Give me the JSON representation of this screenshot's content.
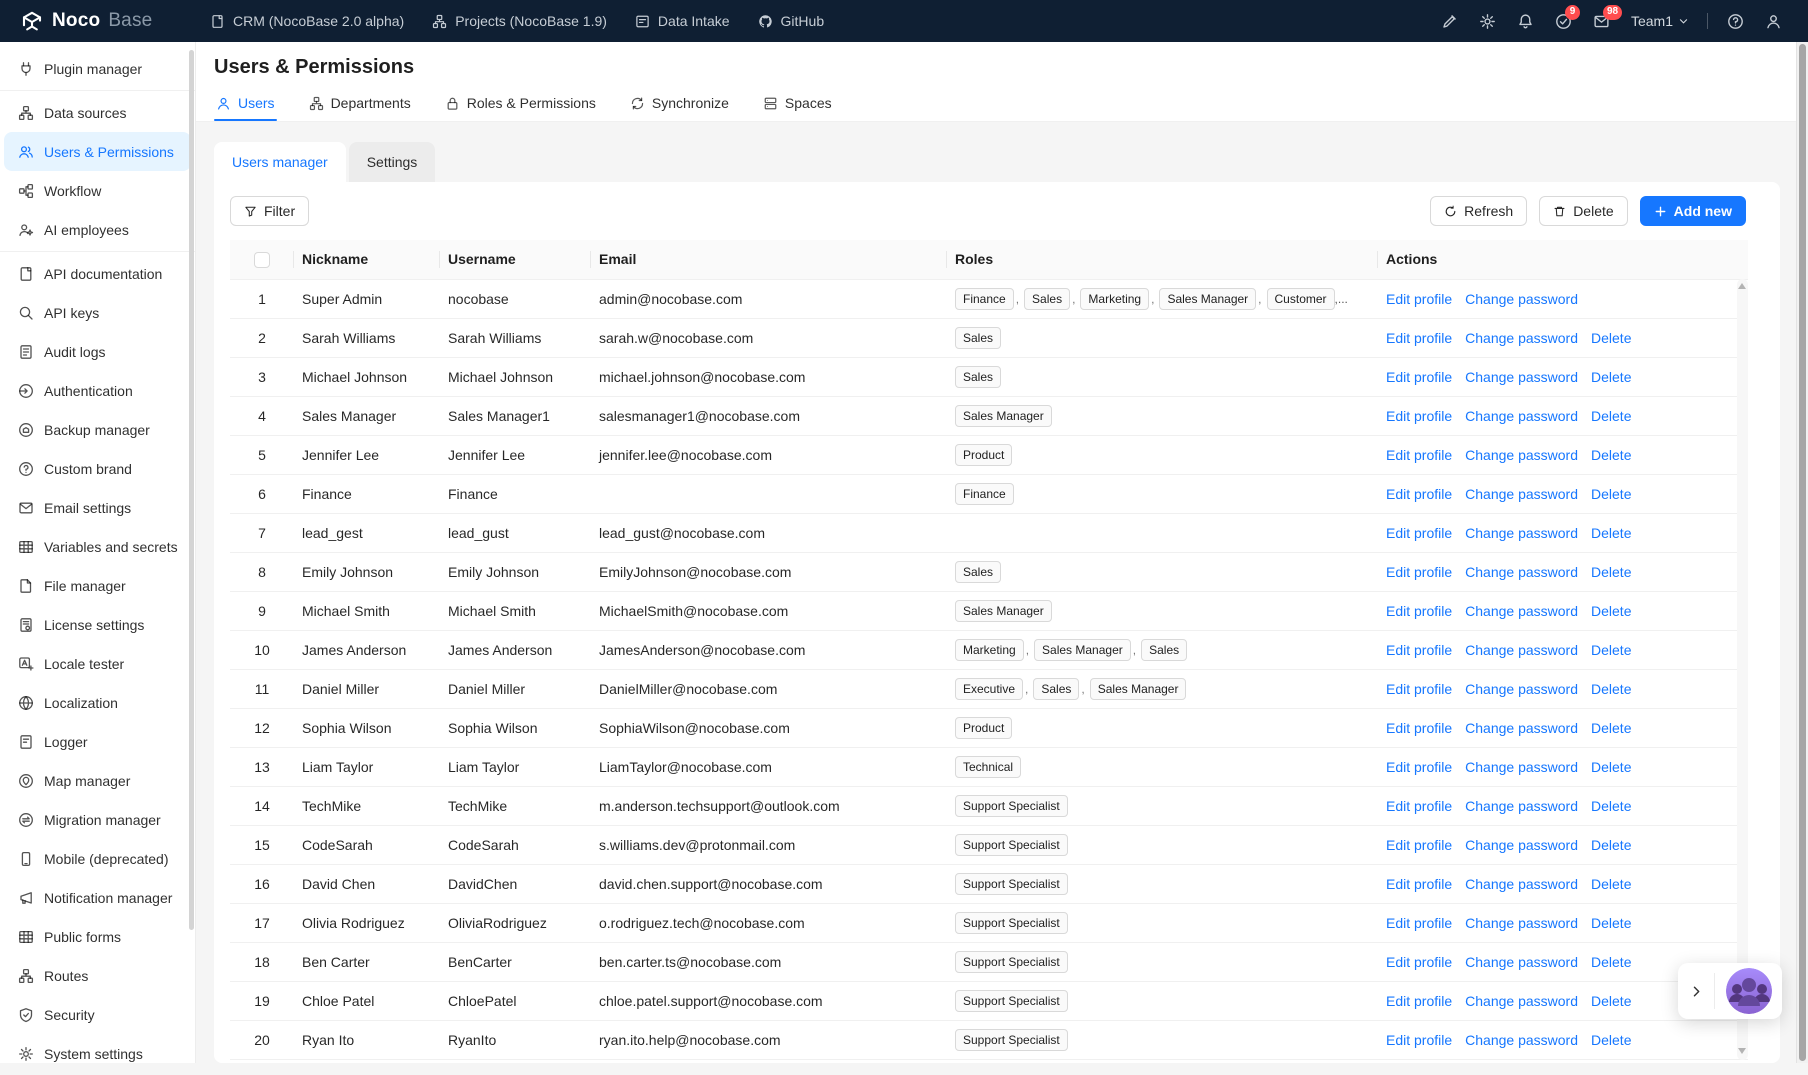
{
  "colors": {
    "accent": "#1677ff",
    "topbar_bg": "#0f1f33",
    "badge": "#ff4d4f",
    "active_item_bg": "#e6f4ff"
  },
  "topbar": {
    "logo": {
      "bold": "Noco",
      "light": "Base"
    },
    "menu": [
      {
        "icon": "doc-icon",
        "label": "CRM (NocoBase 2.0 alpha)"
      },
      {
        "icon": "sitemap-icon",
        "label": "Projects (NocoBase 1.9)"
      },
      {
        "icon": "intake-icon",
        "label": "Data Intake"
      },
      {
        "icon": "github-icon",
        "label": "GitHub"
      }
    ],
    "actions": [
      {
        "icon": "highlighter-icon",
        "badge": ""
      },
      {
        "icon": "gear-icon",
        "badge": ""
      },
      {
        "icon": "bell-icon",
        "badge": ""
      },
      {
        "icon": "todo-icon",
        "badge": "9"
      },
      {
        "icon": "inbox-icon",
        "badge": "98"
      }
    ],
    "team": {
      "label": "Team1"
    }
  },
  "sidebar": {
    "groups": [
      [
        {
          "icon": "plug-icon",
          "label": "Plugin manager",
          "active": false
        }
      ],
      [
        {
          "icon": "sitemap-icon",
          "label": "Data sources",
          "active": false
        },
        {
          "icon": "users-icon",
          "label": "Users & Permissions",
          "active": true
        },
        {
          "icon": "workflow-icon",
          "label": "Workflow",
          "active": false
        },
        {
          "icon": "ai-icon",
          "label": "AI employees",
          "active": false
        }
      ],
      [
        {
          "icon": "api-doc-icon",
          "label": "API documentation",
          "active": false
        },
        {
          "icon": "search-icon",
          "label": "API keys",
          "active": false
        },
        {
          "icon": "audit-icon",
          "label": "Audit logs",
          "active": false
        },
        {
          "icon": "auth-icon",
          "label": "Authentication",
          "active": false
        },
        {
          "icon": "backup-icon",
          "label": "Backup manager",
          "active": false
        },
        {
          "icon": "brand-icon",
          "label": "Custom brand",
          "active": false
        },
        {
          "icon": "mail-icon",
          "label": "Email settings",
          "active": false
        },
        {
          "icon": "grid-icon",
          "label": "Variables and secrets",
          "active": false
        },
        {
          "icon": "file-icon",
          "label": "File manager",
          "active": false
        },
        {
          "icon": "license-icon",
          "label": "License settings",
          "active": false
        },
        {
          "icon": "locale-icon",
          "label": "Locale tester",
          "active": false
        },
        {
          "icon": "globe-icon",
          "label": "Localization",
          "active": false
        },
        {
          "icon": "logger-icon",
          "label": "Logger",
          "active": false
        },
        {
          "icon": "map-icon",
          "label": "Map manager",
          "active": false
        },
        {
          "icon": "migration-icon",
          "label": "Migration manager",
          "active": false
        },
        {
          "icon": "mobile-icon",
          "label": "Mobile (deprecated)",
          "active": false
        },
        {
          "icon": "notification-icon",
          "label": "Notification manager",
          "active": false
        },
        {
          "icon": "forms-icon",
          "label": "Public forms",
          "active": false
        },
        {
          "icon": "routes-icon",
          "label": "Routes",
          "active": false
        },
        {
          "icon": "security-icon",
          "label": "Security",
          "active": false
        },
        {
          "icon": "settings-icon",
          "label": "System settings",
          "active": false
        }
      ]
    ]
  },
  "page": {
    "title": "Users & Permissions",
    "tabs": [
      {
        "icon": "user-icon",
        "label": "Users",
        "active": true
      },
      {
        "icon": "dept-icon",
        "label": "Departments",
        "active": false
      },
      {
        "icon": "lock-icon",
        "label": "Roles & Permissions",
        "active": false
      },
      {
        "icon": "sync-icon",
        "label": "Synchronize",
        "active": false
      },
      {
        "icon": "spaces-icon",
        "label": "Spaces",
        "active": false
      }
    ],
    "subtabs": [
      {
        "label": "Users manager",
        "active": true
      },
      {
        "label": "Settings",
        "active": false
      }
    ]
  },
  "toolbar": {
    "filter_label": "Filter",
    "refresh_label": "Refresh",
    "delete_label": "Delete",
    "add_new_label": "Add new"
  },
  "table": {
    "columns": [
      "Nickname",
      "Username",
      "Email",
      "Roles",
      "Actions"
    ],
    "action_labels": {
      "edit": "Edit profile",
      "change": "Change password",
      "del": "Delete"
    },
    "rows": [
      {
        "n": "1",
        "nickname": "Super Admin",
        "username": "nocobase",
        "email": "admin@nocobase.com",
        "roles": [
          "Finance",
          "Sales",
          "Marketing",
          "Sales Manager",
          "Customer"
        ],
        "more": ",...",
        "can_delete": false
      },
      {
        "n": "2",
        "nickname": "Sarah Williams",
        "username": "Sarah Williams",
        "email": "sarah.w@nocobase.com",
        "roles": [
          "Sales"
        ],
        "more": "",
        "can_delete": true
      },
      {
        "n": "3",
        "nickname": "Michael Johnson",
        "username": "Michael Johnson",
        "email": "michael.johnson@nocobase.com",
        "roles": [
          "Sales"
        ],
        "more": "",
        "can_delete": true
      },
      {
        "n": "4",
        "nickname": "Sales Manager",
        "username": "Sales Manager1",
        "email": "salesmanager1@nocobase.com",
        "roles": [
          "Sales Manager"
        ],
        "more": "",
        "can_delete": true
      },
      {
        "n": "5",
        "nickname": "Jennifer Lee",
        "username": "Jennifer Lee",
        "email": "jennifer.lee@nocobase.com",
        "roles": [
          "Product"
        ],
        "more": "",
        "can_delete": true
      },
      {
        "n": "6",
        "nickname": "Finance",
        "username": "Finance",
        "email": "",
        "roles": [
          "Finance"
        ],
        "more": "",
        "can_delete": true
      },
      {
        "n": "7",
        "nickname": "lead_gest",
        "username": "lead_gust",
        "email": "lead_gust@nocobase.com",
        "roles": [],
        "more": "",
        "can_delete": true
      },
      {
        "n": "8",
        "nickname": "Emily Johnson",
        "username": "Emily Johnson",
        "email": "EmilyJohnson@nocobase.com",
        "roles": [
          "Sales"
        ],
        "more": "",
        "can_delete": true
      },
      {
        "n": "9",
        "nickname": "Michael Smith",
        "username": "Michael Smith",
        "email": "MichaelSmith@nocobase.com",
        "roles": [
          "Sales Manager"
        ],
        "more": "",
        "can_delete": true
      },
      {
        "n": "10",
        "nickname": "James Anderson",
        "username": "James Anderson",
        "email": "JamesAnderson@nocobase.com",
        "roles": [
          "Marketing",
          "Sales Manager",
          "Sales"
        ],
        "more": "",
        "can_delete": true
      },
      {
        "n": "11",
        "nickname": "Daniel Miller",
        "username": "Daniel Miller",
        "email": "DanielMiller@nocobase.com",
        "roles": [
          "Executive",
          "Sales",
          "Sales Manager"
        ],
        "more": "",
        "can_delete": true
      },
      {
        "n": "12",
        "nickname": "Sophia Wilson",
        "username": "Sophia Wilson",
        "email": "SophiaWilson@nocobase.com",
        "roles": [
          "Product"
        ],
        "more": "",
        "can_delete": true
      },
      {
        "n": "13",
        "nickname": "Liam Taylor",
        "username": "Liam Taylor",
        "email": "LiamTaylor@nocobase.com",
        "roles": [
          "Technical"
        ],
        "more": "",
        "can_delete": true
      },
      {
        "n": "14",
        "nickname": "TechMike",
        "username": "TechMike",
        "email": "m.anderson.techsupport@outlook.com",
        "roles": [
          "Support Specialist"
        ],
        "more": "",
        "can_delete": true
      },
      {
        "n": "15",
        "nickname": "CodeSarah",
        "username": "CodeSarah",
        "email": "s.williams.dev@protonmail.com",
        "roles": [
          "Support Specialist"
        ],
        "more": "",
        "can_delete": true
      },
      {
        "n": "16",
        "nickname": "David Chen",
        "username": "DavidChen",
        "email": "david.chen.support@nocobase.com",
        "roles": [
          "Support Specialist"
        ],
        "more": "",
        "can_delete": true
      },
      {
        "n": "17",
        "nickname": "Olivia Rodriguez",
        "username": "OliviaRodriguez",
        "email": "o.rodriguez.tech@nocobase.com",
        "roles": [
          "Support Specialist"
        ],
        "more": "",
        "can_delete": true
      },
      {
        "n": "18",
        "nickname": "Ben Carter",
        "username": "BenCarter",
        "email": "ben.carter.ts@nocobase.com",
        "roles": [
          "Support Specialist"
        ],
        "more": "",
        "can_delete": true
      },
      {
        "n": "19",
        "nickname": "Chloe Patel",
        "username": "ChloePatel",
        "email": "chloe.patel.support@nocobase.com",
        "roles": [
          "Support Specialist"
        ],
        "more": "",
        "can_delete": true
      },
      {
        "n": "20",
        "nickname": "Ryan Ito",
        "username": "RyanIto",
        "email": "ryan.ito.help@nocobase.com",
        "roles": [
          "Support Specialist"
        ],
        "more": "",
        "can_delete": true
      }
    ]
  }
}
